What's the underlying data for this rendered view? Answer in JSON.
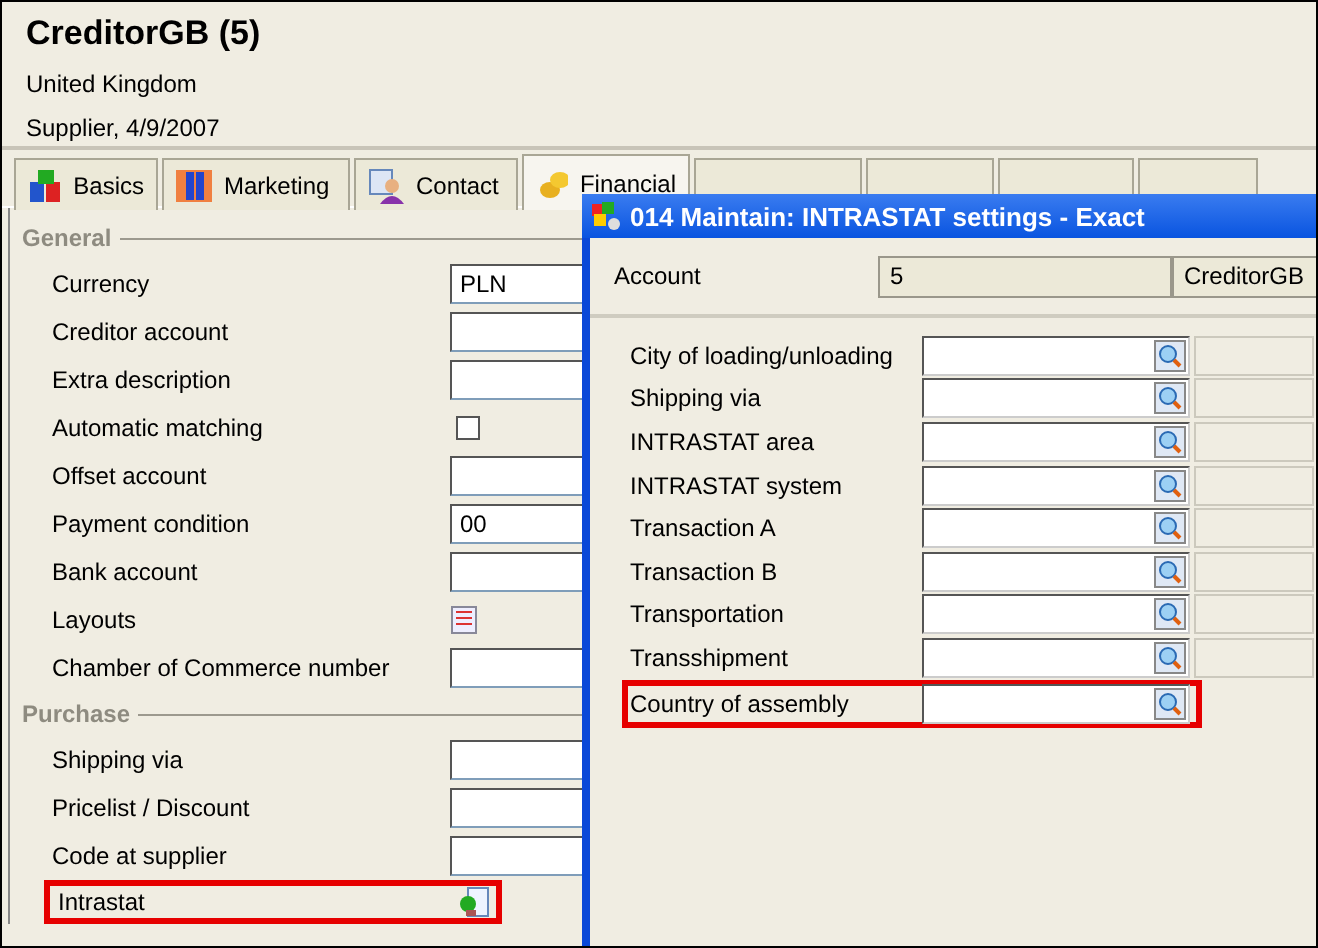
{
  "header": {
    "title": "CreditorGB (5)",
    "lines": [
      "United Kingdom",
      "Supplier, 4/9/2007"
    ]
  },
  "tabs": [
    {
      "label": "Basics",
      "kind": "blocks",
      "selected": false
    },
    {
      "label": "Marketing",
      "kind": "people",
      "selected": false
    },
    {
      "label": "Contact",
      "kind": "person",
      "selected": false
    },
    {
      "label": "Financial",
      "kind": "coins",
      "selected": true
    },
    {
      "kind": "blank",
      "selected": false
    },
    {
      "kind": "blank",
      "selected": false
    },
    {
      "kind": "blank",
      "selected": false
    },
    {
      "kind": "blank",
      "selected": false
    }
  ],
  "sections": [
    {
      "title": "General",
      "rows": [
        {
          "label": "Currency",
          "kind": "input",
          "value": "PLN"
        },
        {
          "label": "Creditor account",
          "kind": "input"
        },
        {
          "label": "Extra description",
          "kind": "input"
        },
        {
          "label": "Automatic matching",
          "kind": "checkbox",
          "checked": false
        },
        {
          "label": "Offset account",
          "kind": "input"
        },
        {
          "label": "Payment condition",
          "kind": "input",
          "value": "00"
        },
        {
          "label": "Bank account",
          "kind": "input"
        },
        {
          "label": "Layouts",
          "kind": "layouts"
        },
        {
          "label": "Chamber of Commerce number",
          "kind": "input"
        }
      ]
    },
    {
      "title": "Purchase",
      "rows": [
        {
          "label": "Shipping via",
          "kind": "input"
        },
        {
          "label": "Pricelist / Discount",
          "kind": "input"
        },
        {
          "label": "Code at supplier",
          "kind": "input"
        },
        {
          "label": "Intrastat",
          "kind": "intrastat",
          "highlighted": true
        }
      ]
    }
  ],
  "dialog": {
    "title": "014 Maintain: INTRASTAT settings - Exact",
    "account": {
      "label": "Account",
      "number": "5",
      "name": "CreditorGB"
    },
    "fields": [
      {
        "label": "City of loading/unloading",
        "highlighted": false
      },
      {
        "label": "Shipping via",
        "highlighted": false
      },
      {
        "label": "INTRASTAT area",
        "highlighted": false
      },
      {
        "label": "INTRASTAT system",
        "highlighted": false
      },
      {
        "label": "Transaction A",
        "highlighted": false
      },
      {
        "label": "Transaction B",
        "highlighted": false
      },
      {
        "label": "Transportation",
        "highlighted": false
      },
      {
        "label": "Transshipment",
        "highlighted": false
      },
      {
        "label": "Country of assembly",
        "highlighted": true
      }
    ]
  }
}
